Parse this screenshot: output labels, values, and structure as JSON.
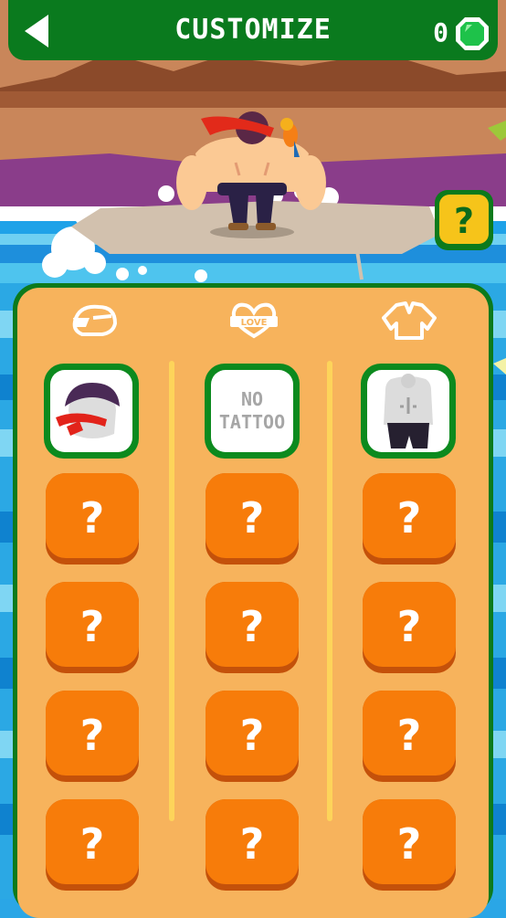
{
  "header": {
    "title": "CUSTOMIZE",
    "gem_count": "0"
  },
  "help_button": {
    "label": "?"
  },
  "tabs": [
    {
      "name": "headgear",
      "icon": "hair-headband-icon"
    },
    {
      "name": "tattoo",
      "icon": "love-heart-tattoo-icon",
      "icon_text": "LOVE"
    },
    {
      "name": "outfit",
      "icon": "shirt-icon"
    }
  ],
  "items": {
    "col1_selected": "hair-red-headband",
    "col2_selected": "NO\nTATTOO",
    "col3_selected": "bare-torso-pants",
    "locked_label": "?"
  },
  "colors": {
    "header_green": "#0a7a1e",
    "panel_bg": "#f7b35c",
    "locked_orange": "#f77c0a",
    "help_yellow": "#f6c41a"
  }
}
